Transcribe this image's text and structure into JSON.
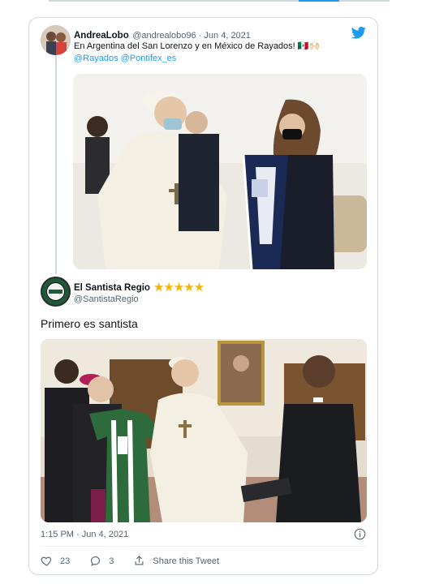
{
  "quoted_tweet": {
    "author_name": "AndreaLobo",
    "author_handle": "@andrealobo96",
    "separator": " · ",
    "date": "Jun 4, 2021",
    "text": "En Argentina del San Lorenzo y en México de Rayados! 🇲🇽🙌🏻",
    "mentions": [
      "@Rayados",
      "@Pontifex_es"
    ],
    "image": "photo-pope-rayados-scarf"
  },
  "main_tweet": {
    "author_name": "El Santista Regio",
    "stars": "★★★★★",
    "author_handle": "@SantistaRegio",
    "text": "Primero es santista",
    "image": "photo-pope-santos-jersey",
    "timestamp": "1:15 PM · Jun 4, 2021",
    "likes": "23",
    "replies": "3",
    "share_label": "Share this Tweet"
  },
  "colors": {
    "link": "#1d9bf0",
    "secondary_text": "#536471",
    "star": "#f4b400",
    "border": "#cfd9de"
  },
  "icons": [
    "twitter-bird-icon",
    "heart-icon",
    "reply-icon",
    "share-icon",
    "info-icon"
  ]
}
